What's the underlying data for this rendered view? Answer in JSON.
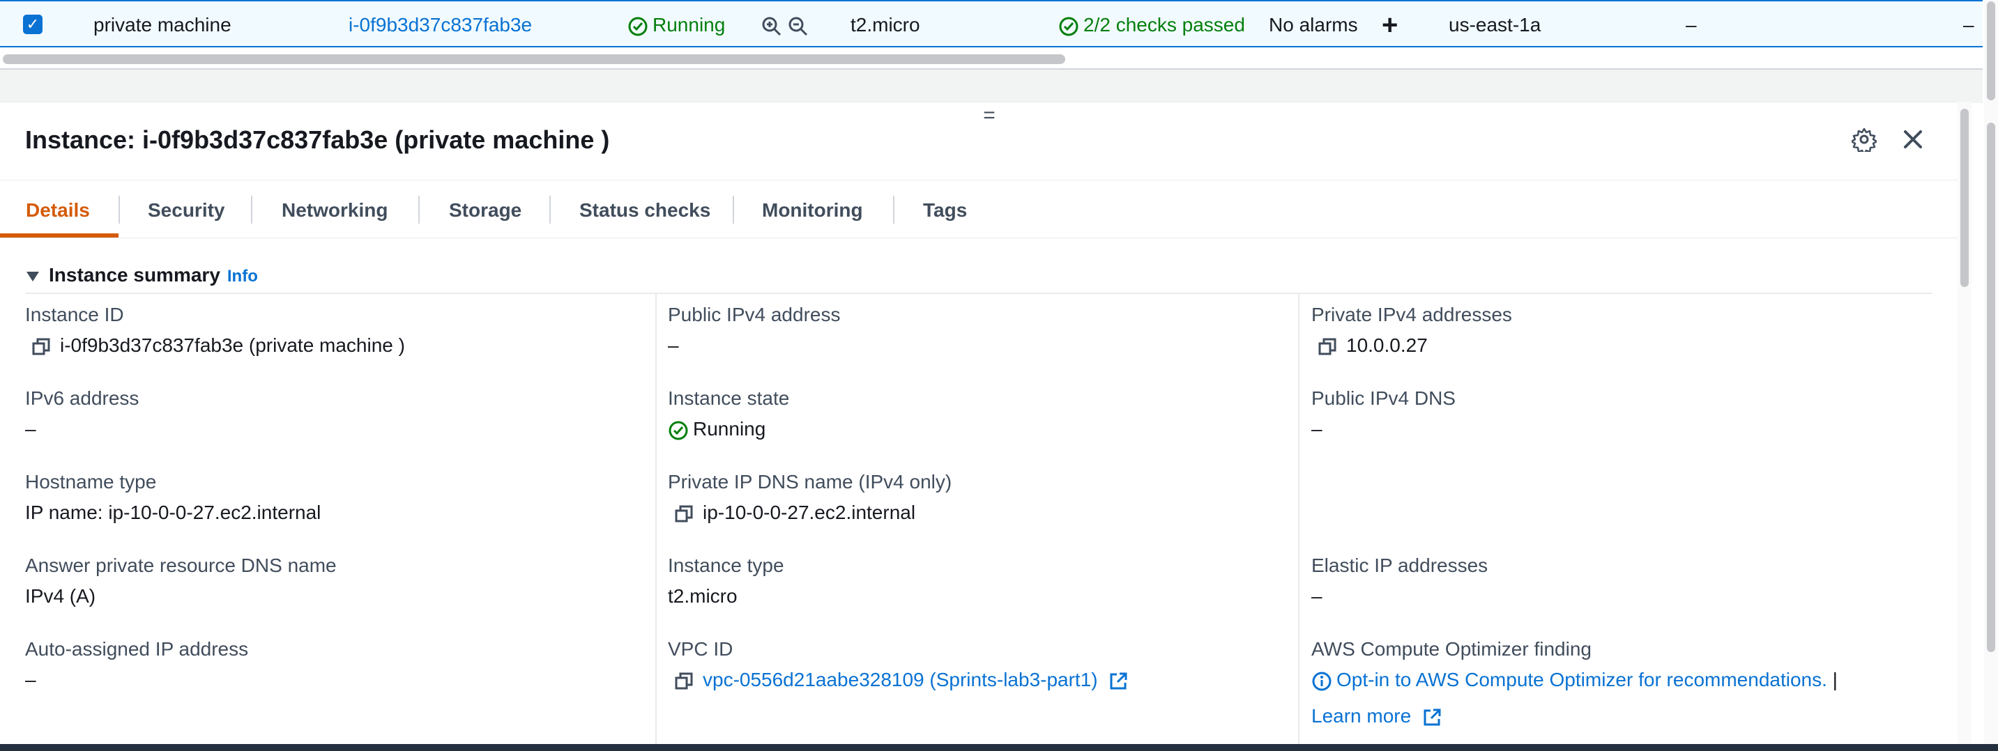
{
  "table_row": {
    "checked": true,
    "name": "private machine",
    "instance_id": "i-0f9b3d37c837fab3e",
    "state": "Running",
    "type": "t2.micro",
    "status_check": "2/2 checks passed",
    "alarm_status": "No alarms",
    "add_alarm": "+",
    "az": "us-east-1a",
    "col_dash_1": "–",
    "col_dash_2": "–"
  },
  "panel": {
    "drag_handle": "=",
    "title": "Instance: i-0f9b3d37c837fab3e (private machine )",
    "tabs": [
      {
        "label": "Details",
        "active": true
      },
      {
        "label": "Security"
      },
      {
        "label": "Networking"
      },
      {
        "label": "Storage"
      },
      {
        "label": "Status checks"
      },
      {
        "label": "Monitoring"
      },
      {
        "label": "Tags"
      }
    ],
    "summary": {
      "heading": "Instance summary",
      "info": "Info"
    },
    "fields": {
      "instance_id": {
        "label": "Instance ID",
        "value": "i-0f9b3d37c837fab3e (private machine )"
      },
      "ipv6": {
        "label": "IPv6 address",
        "value": "–"
      },
      "hostname_type": {
        "label": "Hostname type",
        "value": "IP name: ip-10-0-0-27.ec2.internal"
      },
      "answer_dns": {
        "label": "Answer private resource DNS name",
        "value": "IPv4 (A)"
      },
      "auto_ip": {
        "label": "Auto-assigned IP address",
        "value": "–"
      },
      "public_ipv4": {
        "label": "Public IPv4 address",
        "value": "–"
      },
      "instance_state": {
        "label": "Instance state",
        "value": "Running"
      },
      "private_dns": {
        "label": "Private IP DNS name (IPv4 only)",
        "value": "ip-10-0-0-27.ec2.internal"
      },
      "instance_type": {
        "label": "Instance type",
        "value": "t2.micro"
      },
      "vpc_id": {
        "label": "VPC ID",
        "value": "vpc-0556d21aabe328109 (Sprints-lab3-part1)"
      },
      "private_ipv4": {
        "label": "Private IPv4 addresses",
        "value": "10.0.0.27"
      },
      "public_dns": {
        "label": "Public IPv4 DNS",
        "value": "–"
      },
      "elastic_ip": {
        "label": "Elastic IP addresses",
        "value": "–"
      },
      "optimizer": {
        "label": "AWS Compute Optimizer finding",
        "link": "Opt-in to AWS Compute Optimizer for recommendations.",
        "separator": "|",
        "learn_more": "Learn more"
      }
    }
  },
  "colors": {
    "link": "#0972d3",
    "success": "#037f0c",
    "active_tab": "#d45b07"
  }
}
